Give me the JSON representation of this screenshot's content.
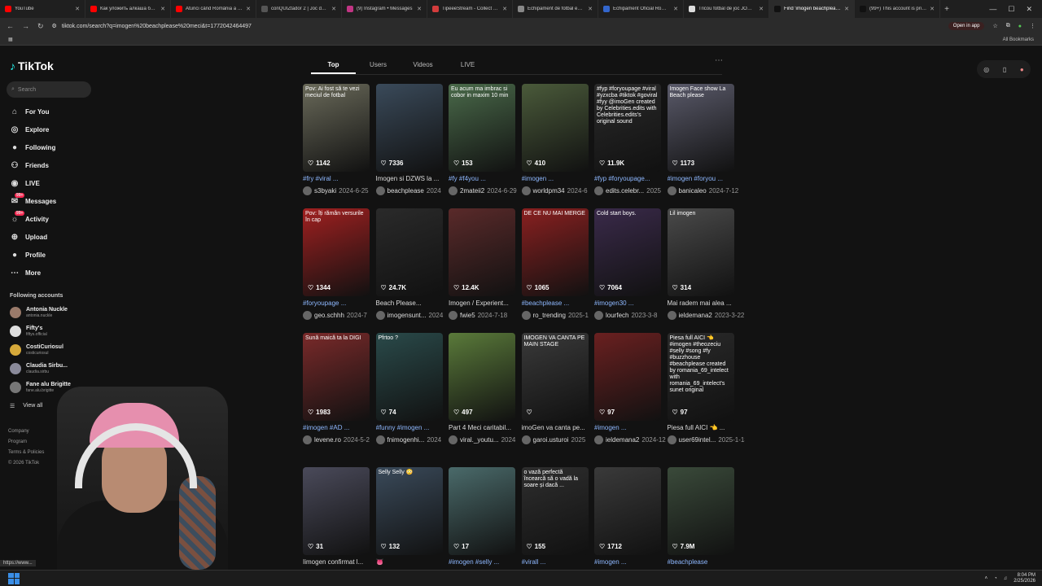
{
  "browser": {
    "tabs": [
      {
        "title": "YouTube",
        "color": "#ff0000"
      },
      {
        "title": "Как уложить алкаша без...",
        "color": "#ff0000"
      },
      {
        "title": "Atunci când România a F...",
        "color": "#ff0000"
      },
      {
        "title": "conQUIZtador 2 | Joc de ...",
        "color": "#555555"
      },
      {
        "title": "(9) Instagram • Messages",
        "color": "#c13584"
      },
      {
        "title": "TipeeeStream - Collect Ti...",
        "color": "#d33c3c"
      },
      {
        "title": "Echipament de fotbal edi...",
        "color": "#888888"
      },
      {
        "title": "Echipament Oficial Român...",
        "color": "#3366cc"
      },
      {
        "title": "Tricou fotbal de joc JOMA...",
        "color": "#dddddd"
      },
      {
        "title": "Find 'imogen beachplease...",
        "color": "#111111",
        "active": true
      },
      {
        "title": "(99+) This account is priva...",
        "color": "#111111"
      }
    ],
    "url": "tiktok.com/search?q=imogen%20beachplease%20meci&t=1772042464497",
    "open_in_app": "Open in app",
    "all_bookmarks": "All Bookmarks",
    "status_url": "https://www..."
  },
  "sidebar": {
    "logo": "TikTok",
    "search_placeholder": "Search",
    "nav": [
      {
        "label": "For You",
        "icon": "home-icon",
        "glyph": "⌂"
      },
      {
        "label": "Explore",
        "icon": "compass-icon",
        "glyph": "◎"
      },
      {
        "label": "Following",
        "icon": "following-avatar-icon",
        "glyph": "●"
      },
      {
        "label": "Friends",
        "icon": "friends-icon",
        "glyph": "⚇"
      },
      {
        "label": "LIVE",
        "icon": "live-icon",
        "glyph": "◉"
      },
      {
        "label": "Messages",
        "icon": "messages-icon",
        "glyph": "✉",
        "badge": "99+"
      },
      {
        "label": "Activity",
        "icon": "activity-icon",
        "glyph": "☼",
        "badge": "99+"
      },
      {
        "label": "Upload",
        "icon": "upload-icon",
        "glyph": "⊕"
      },
      {
        "label": "Profile",
        "icon": "profile-avatar-icon",
        "glyph": "●"
      },
      {
        "label": "More",
        "icon": "more-icon",
        "glyph": "⋯"
      }
    ],
    "following_title": "Following accounts",
    "accounts": [
      {
        "name": "Antonia Nuckle",
        "handle": "antonia.nuckle",
        "color": "#9a7a6a"
      },
      {
        "name": "Fifty's",
        "handle": "fiftys.official",
        "color": "#dddddd"
      },
      {
        "name": "CostiCuriosul",
        "handle": "costicuriosul",
        "color": "#d6a93a"
      },
      {
        "name": "Claudia Sirbu...",
        "handle": "claudia.sirbu",
        "color": "#8a8a9a"
      },
      {
        "name": "Fane alu Brigitte",
        "handle": "fane.alu.brigitte",
        "color": "#777777"
      }
    ],
    "view_all": "View all",
    "footer": [
      "Company",
      "Program",
      "Terms & Policies",
      "© 2026 TikTok"
    ]
  },
  "search_tabs": [
    "Top",
    "Users",
    "Videos",
    "LIVE"
  ],
  "videos": [
    {
      "overlay": "Pov: Ai fost să te vezi meciul de fotbal",
      "views": "1142",
      "caption": "#fry #viral ...",
      "author": "s3byaki",
      "date": "2024-6-25",
      "bg": "#6a6a5a",
      "tag": true
    },
    {
      "overlay": "",
      "views": "7336",
      "caption": "Imogen si DZWS la ...",
      "author": "beachplease",
      "date": "2024",
      "bg": "#3a4a5a",
      "tag": false
    },
    {
      "overlay": "Eu acum ma imbrac si cobor in maxim 10 min",
      "views": "153",
      "caption": "#fy #f4you ...",
      "author": "2mateii2",
      "date": "2024-6-29",
      "bg": "#4a6a4a",
      "tag": true
    },
    {
      "overlay": "",
      "views": "410",
      "caption": "#imogen ...",
      "author": "worldpm34",
      "date": "2024-6",
      "bg": "#4a5a3a",
      "tag": true
    },
    {
      "overlay": "#fyp #foryoupage #viral #yzxcba #tiktok #goviral #fyy @imoGen created by Celebrities.edits with Celebrities.edits's original sound",
      "views": "11.9K",
      "caption": "#fyp #foryoupage...",
      "author": "edits.celebr...",
      "date": "2025",
      "bg": "#2a2a2a",
      "tag": true
    },
    {
      "overlay": "Imogen Face show La Beach please",
      "views": "1173",
      "caption": "#imogen #foryou ...",
      "author": "banicaleo",
      "date": "2024-7-12",
      "bg": "#5a5a6a",
      "tag": true
    },
    {
      "overlay": "Pov: îți rămân versurile în cap",
      "views": "1344",
      "caption": "#foryoupage ...",
      "author": "geo.schhh",
      "date": "2024-7",
      "bg": "#a02020",
      "tag": true
    },
    {
      "overlay": "",
      "views": "24.7K",
      "caption": "Beach Please...",
      "author": "imogensunt...",
      "date": "2024",
      "bg": "#2a2a2a",
      "tag": false
    },
    {
      "overlay": "",
      "views": "12.4K",
      "caption": "Imogen / Experient...",
      "author": "fwie5",
      "date": "2024-7-18",
      "bg": "#5a2a2a",
      "tag": false
    },
    {
      "overlay": "DE CE NU MAI MERGE",
      "views": "1065",
      "caption": "#beachplease ...",
      "author": "ro_trending",
      "date": "2025-1",
      "bg": "#8a2020",
      "tag": true
    },
    {
      "overlay": "Cold start boys.",
      "views": "7064",
      "caption": "#imogen30 ...",
      "author": "lourfech",
      "date": "2023-3-8",
      "bg": "#3a2a4a",
      "tag": true
    },
    {
      "overlay": "Lil imogen",
      "views": "314",
      "caption": "Mai radem mai alea ...",
      "author": "ieldemana2",
      "date": "2023-3-22",
      "bg": "#4a4a4a",
      "tag": false
    },
    {
      "overlay": "Sună maică ta la DIGI",
      "views": "1983",
      "caption": "#imogen #AD ...",
      "author": "levene.ro",
      "date": "2024-5-2",
      "bg": "#7a2a2a",
      "tag": true
    },
    {
      "overlay": "Pfrtoo ?",
      "views": "74",
      "caption": "#funny #imogen ...",
      "author": "fnimogenhi...",
      "date": "2024",
      "bg": "#2a4a4a",
      "tag": true
    },
    {
      "overlay": "",
      "views": "497",
      "caption": "Part 4 Meci caritabil...",
      "author": "viral._youtu...",
      "date": "2024",
      "bg": "#5a7a3a",
      "tag": false
    },
    {
      "overlay": "IMOGEN VA CANTA PE MAIN STAGE",
      "views": "",
      "caption": "imoGen va canta pe...",
      "author": "garoi.usturoi",
      "date": "2025",
      "bg": "#3a3a3a",
      "tag": false
    },
    {
      "overlay": "",
      "views": "97",
      "caption": "#imogen ...",
      "author": "ieldemana2",
      "date": "2024-12",
      "bg": "#6a2020",
      "tag": true
    },
    {
      "overlay": "Piesa full AICI 👈 #imogen #theozeciu #selly #song #fy #buzzhouse #beachplease created by romania_69_intelect with romania_69_intelect's sunet original",
      "views": "97",
      "caption": "Piesa full AICI 👈 ...",
      "author": "user69intel...",
      "date": "2025-1-13",
      "bg": "#2a2a2a",
      "tag": false
    },
    {
      "overlay": "",
      "views": "31",
      "caption": "Iimogen confirmat l...",
      "author": "",
      "date": "",
      "bg": "#4a4a5a",
      "tag": false
    },
    {
      "overlay": "Selly Selly 😳",
      "views": "132",
      "caption": "👅",
      "author": "",
      "date": "",
      "bg": "#3a4a5a",
      "tag": false
    },
    {
      "overlay": "",
      "views": "17",
      "caption": "#imogen #selly ...",
      "author": "",
      "date": "",
      "bg": "#4a6a6a",
      "tag": true
    },
    {
      "overlay": "o vază perfectă încearcă să o vadă la soare și dacă ...",
      "views": "155",
      "caption": "#virall ...",
      "author": "",
      "date": "",
      "bg": "#2e2e2e",
      "tag": true
    },
    {
      "overlay": "",
      "views": "1712",
      "caption": "#imogen ...",
      "author": "",
      "date": "",
      "bg": "#3a3a3a",
      "tag": true
    },
    {
      "overlay": "",
      "views": "7.9M",
      "caption": "#beachplease",
      "author": "",
      "date": "",
      "bg": "#3a4a3a",
      "tag": true
    }
  ],
  "taskbar": {
    "time": "8:04 PM",
    "date": "2/25/2026"
  }
}
